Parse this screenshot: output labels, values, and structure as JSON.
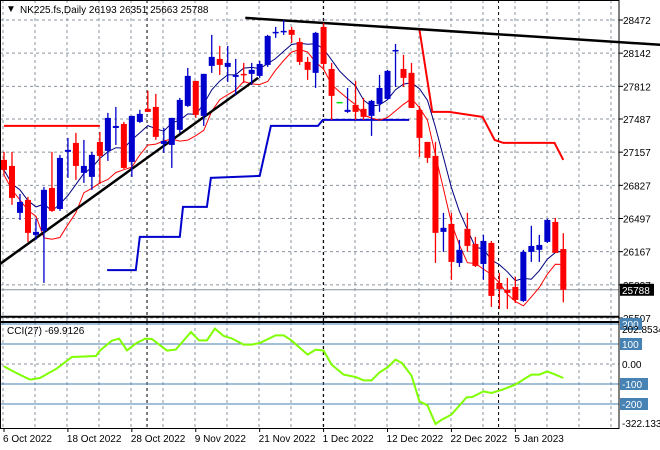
{
  "chart_data": [
    {
      "type": "candlestick",
      "title": "NK225.fs,Daily",
      "ohlc_readout": {
        "open": "26193",
        "high": "26351",
        "low": "25663",
        "close": "25788"
      },
      "y_ticks": [
        "28472",
        "28142",
        "27812",
        "27487",
        "27157",
        "26827",
        "26497",
        "26167",
        "25837",
        "25507"
      ],
      "ylim": [
        25507,
        28472
      ],
      "current_price_label": "25788",
      "current_price": 25788,
      "x_labels": [
        {
          "index": 1,
          "text": "6 Oct 2022"
        },
        {
          "index": 9,
          "text": "18 Oct 2022"
        },
        {
          "index": 17,
          "text": "28 Oct 2022"
        },
        {
          "index": 25,
          "text": "9 Nov 2022"
        },
        {
          "index": 33,
          "text": "21 Nov 2022"
        },
        {
          "index": 41,
          "text": "1 Dec 2022"
        },
        {
          "index": 49,
          "text": "12 Dec 2022"
        },
        {
          "index": 57,
          "text": "22 Dec 2022"
        },
        {
          "index": 65,
          "text": "5 Jan 2023"
        }
      ],
      "period_separators": [
        18.9,
        41,
        62.9
      ],
      "candles": [
        [
          27080,
          27160,
          26931,
          26980
        ],
        [
          27020,
          27160,
          26632,
          26702
        ],
        [
          26553,
          26742,
          26483,
          26662
        ],
        [
          26682,
          26712,
          26264,
          26354
        ],
        [
          26334,
          26493,
          26284,
          26364
        ],
        [
          26374,
          26811,
          25856,
          26782
        ],
        [
          26801,
          27160,
          26563,
          26573
        ],
        [
          26592,
          27130,
          26573,
          27100
        ],
        [
          27160,
          27299,
          26901,
          27180
        ],
        [
          27249,
          27349,
          26881,
          27020
        ],
        [
          26951,
          27279,
          26851,
          27020
        ],
        [
          26911,
          27160,
          26782,
          27130
        ],
        [
          27259,
          27359,
          26841,
          27120
        ],
        [
          27170,
          27548,
          27070,
          27498
        ],
        [
          27398,
          27607,
          27229,
          27418
        ],
        [
          27438,
          27458,
          26990,
          27000
        ],
        [
          27060,
          27518,
          26911,
          27518
        ],
        [
          27458,
          27578,
          27448,
          27538
        ],
        [
          27588,
          27767,
          27558,
          27558
        ],
        [
          27607,
          27737,
          27279,
          27309
        ],
        [
          27239,
          27398,
          27150,
          27269
        ],
        [
          27229,
          27498,
          27000,
          27498
        ],
        [
          27379,
          27697,
          27349,
          27677
        ],
        [
          27617,
          27995,
          27607,
          27916
        ],
        [
          27866,
          27866,
          27498,
          27528
        ],
        [
          27518,
          27936,
          27418,
          27936
        ],
        [
          28015,
          28324,
          27946,
          28105
        ],
        [
          28085,
          28214,
          27926,
          28025
        ],
        [
          28005,
          28214,
          27856,
          28045
        ],
        [
          27906,
          28085,
          27727,
          27926
        ],
        [
          27936,
          28045,
          27846,
          27926
        ],
        [
          27936,
          28045,
          27826,
          27976
        ],
        [
          27916,
          28065,
          27896,
          28035
        ],
        [
          28025,
          28324,
          28005,
          28314
        ],
        [
          28344,
          28403,
          28294,
          28354
        ],
        [
          28354,
          28473,
          28324,
          28364
        ],
        [
          28374,
          28403,
          28244,
          28324
        ],
        [
          28254,
          28294,
          28025,
          28055
        ],
        [
          28055,
          28105,
          27876,
          27976
        ],
        [
          27946,
          28354,
          27796,
          28344
        ],
        [
          28403,
          28443,
          27976,
          28035
        ],
        [
          27985,
          28045,
          27478,
          27717
        ],
        [
          27657,
          27657,
          27657,
          27657
        ],
        [
          27558,
          27796,
          27548,
          27578
        ],
        [
          27627,
          27866,
          27478,
          27558
        ],
        [
          27588,
          27697,
          27478,
          27508
        ],
        [
          27518,
          27677,
          27319,
          27667
        ],
        [
          27637,
          27926,
          27558,
          27796
        ],
        [
          27687,
          27976,
          27677,
          27966
        ],
        [
          28170,
          28234,
          27806,
          28174
        ],
        [
          27985,
          28125,
          27806,
          27896
        ],
        [
          27946,
          28045,
          27597,
          27597
        ],
        [
          27577,
          27617,
          27110,
          27299
        ],
        [
          27259,
          27259,
          27050,
          27100
        ],
        [
          27120,
          27259,
          26055,
          26354
        ],
        [
          26364,
          26553,
          26165,
          26404
        ],
        [
          26443,
          26553,
          25886,
          26065
        ],
        [
          26055,
          26284,
          26015,
          26185
        ],
        [
          26394,
          26553,
          26165,
          26224
        ],
        [
          26244,
          26314,
          26015,
          26025
        ],
        [
          26045,
          26334,
          25886,
          26274
        ],
        [
          26254,
          26274,
          25617,
          25727
        ],
        [
          25856,
          25956,
          25597,
          25796
        ],
        [
          25786,
          25906,
          25597,
          25757
        ],
        [
          25816,
          25916,
          25657,
          25687
        ],
        [
          25677,
          26185,
          25667,
          26165
        ],
        [
          26165,
          26424,
          26065,
          26224
        ],
        [
          26185,
          26334,
          26065,
          26234
        ],
        [
          26264,
          26493,
          26254,
          26483
        ],
        [
          26463,
          26503,
          26155,
          26155
        ],
        [
          26193,
          26351,
          25663,
          25788
        ]
      ],
      "red_step_line": [
        [
          1,
          27418
        ],
        [
          13,
          27418
        ],
        null,
        [
          53,
          28373
        ],
        [
          54.6,
          27558
        ],
        [
          56.7,
          27558
        ],
        [
          60.9,
          27508
        ],
        [
          62.4,
          27279
        ],
        [
          63.5,
          27249
        ],
        [
          69.9,
          27249
        ],
        [
          71,
          27080
        ]
      ],
      "blue_step_line": [
        [
          13.9,
          25984
        ],
        [
          17.5,
          25984
        ],
        [
          18,
          26314
        ],
        [
          23,
          26314
        ],
        [
          23.4,
          26612
        ],
        [
          26.4,
          26612
        ],
        [
          26.9,
          26901
        ],
        [
          33,
          26921
        ],
        [
          34.4,
          27418
        ],
        [
          40.3,
          27418
        ],
        [
          40.9,
          27478
        ],
        [
          51.7,
          27478
        ]
      ],
      "trendlines": [
        {
          "from": [
            0.5,
            26045
          ],
          "to": [
            32.8,
            27896
          ]
        },
        {
          "from": [
            31.2,
            28493
          ],
          "to": [
            83.4,
            28224
          ]
        }
      ],
      "support_line": 25520,
      "colors": {
        "bull": "#0000cc",
        "bear": "#ff0000",
        "ma_fast": "#000080",
        "ma_slow": "#ff0000",
        "cci": "#7fff00",
        "level": "#4682b4"
      }
    },
    {
      "type": "line",
      "title": "CCI(27) -69.9126",
      "ylim": [
        -322.133,
        202.8534
      ],
      "top_label": "202.8534",
      "bottom_label": "-322.133",
      "zero_label": "0.00",
      "levels": [
        {
          "value": 200,
          "text": "200"
        },
        {
          "value": 100,
          "text": "100"
        },
        {
          "value": -100,
          "text": "-100"
        },
        {
          "value": -200,
          "text": "-200"
        }
      ],
      "points": [
        [
          1,
          -12
        ],
        [
          2.6,
          -46
        ],
        [
          4.25,
          -78
        ],
        [
          5.5,
          -70
        ],
        [
          7.6,
          -23
        ],
        [
          9.5,
          35
        ],
        [
          12.5,
          40
        ],
        [
          13,
          67
        ],
        [
          14.5,
          117
        ],
        [
          15.4,
          127
        ],
        [
          16.4,
          68
        ],
        [
          17.6,
          105
        ],
        [
          18.7,
          127
        ],
        [
          19.5,
          125
        ],
        [
          21.4,
          67
        ],
        [
          22.5,
          72
        ],
        [
          24.4,
          160
        ],
        [
          25.4,
          118
        ],
        [
          26.4,
          118
        ],
        [
          27.4,
          177
        ],
        [
          28.5,
          140
        ],
        [
          29.5,
          128
        ],
        [
          31,
          97
        ],
        [
          32,
          97
        ],
        [
          33,
          105
        ],
        [
          35,
          143
        ],
        [
          36,
          143
        ],
        [
          37,
          117
        ],
        [
          39,
          47
        ],
        [
          40,
          72
        ],
        [
          41,
          67
        ],
        [
          42,
          -3
        ],
        [
          43.5,
          -53
        ],
        [
          45,
          -65
        ],
        [
          46,
          -82
        ],
        [
          47,
          -82
        ],
        [
          48,
          -42
        ],
        [
          49,
          -17
        ],
        [
          50,
          22
        ],
        [
          50.8,
          5
        ],
        [
          52,
          -58
        ],
        [
          53,
          -187
        ],
        [
          54,
          -207
        ],
        [
          55,
          -300
        ],
        [
          55.8,
          -278
        ],
        [
          57,
          -253
        ],
        [
          58.9,
          -167
        ],
        [
          59.6,
          -165
        ],
        [
          61,
          -137
        ],
        [
          62,
          -145
        ],
        [
          63.4,
          -128
        ],
        [
          65,
          -103
        ],
        [
          67,
          -53
        ],
        [
          68,
          -53
        ],
        [
          69,
          -37
        ],
        [
          70,
          -53
        ],
        [
          71,
          -70
        ]
      ]
    }
  ]
}
